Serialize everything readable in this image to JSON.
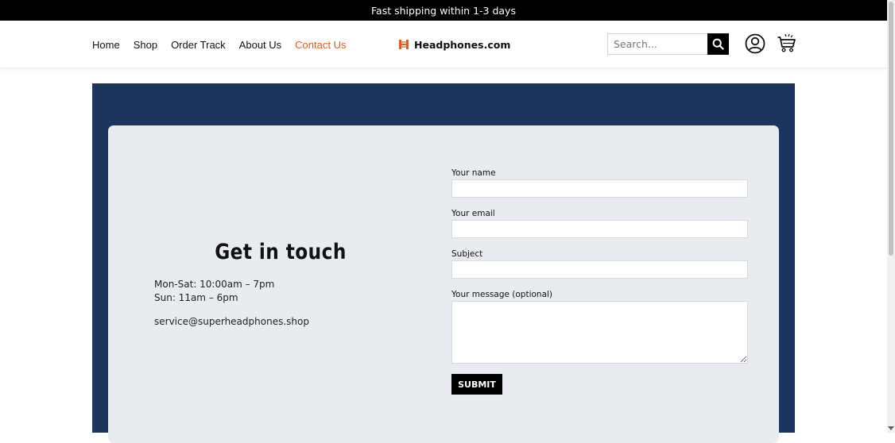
{
  "announcement": "Fast shipping within 1-3 days",
  "nav": {
    "items": [
      {
        "label": "Home",
        "active": false
      },
      {
        "label": "Shop",
        "active": false
      },
      {
        "label": "Order Track",
        "active": false
      },
      {
        "label": "About Us",
        "active": false
      },
      {
        "label": "Contact Us",
        "active": true
      }
    ]
  },
  "brand": {
    "name": "Headphones.com",
    "logo_icon": "headphones-logo-icon",
    "logo_color": "#e35b1c"
  },
  "search": {
    "placeholder": "Search...",
    "button_icon": "search-icon"
  },
  "header_icons": {
    "account": "user-circle-icon",
    "cart": "shopping-cart-icon"
  },
  "colors": {
    "topbar": "#000000",
    "hero": "#1c355e",
    "card": "#e8ebef",
    "accent": "#e35b1c",
    "button": "#000000"
  },
  "contact": {
    "title": "Get in touch",
    "hours_weekday": "Mon-Sat: 10:00am – 7pm",
    "hours_sunday": "Sun: 11am – 6pm",
    "email": "service@superheadphones.shop"
  },
  "form": {
    "name_label": "Your name",
    "name_value": "",
    "email_label": "Your email",
    "email_value": "",
    "subject_label": "Subject",
    "subject_value": "",
    "message_label": "Your message (optional)",
    "message_value": "",
    "submit_label": "SUBMIT"
  }
}
